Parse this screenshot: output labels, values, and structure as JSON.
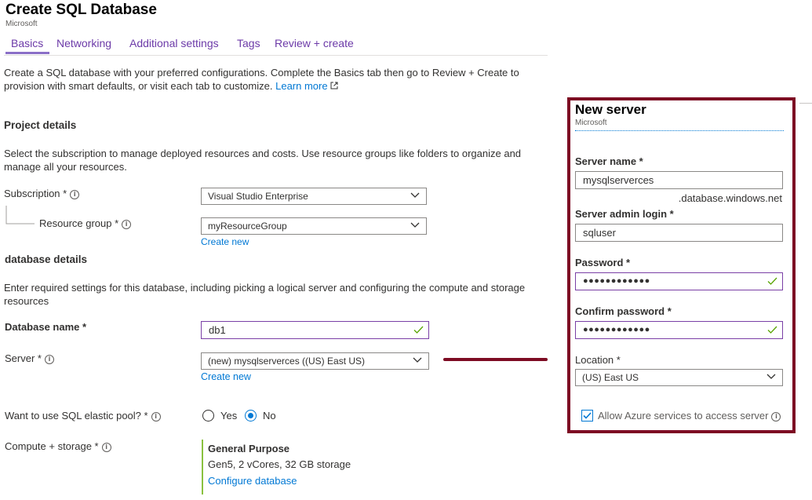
{
  "header": {
    "title": "Create SQL Database",
    "publisher": "Microsoft"
  },
  "tabs": [
    {
      "label": "Basics"
    },
    {
      "label": "Networking"
    },
    {
      "label": "Additional settings"
    },
    {
      "label": "Tags"
    },
    {
      "label": "Review + create"
    }
  ],
  "intro": {
    "line1": "Create a SQL database with your preferred configurations. Complete the Basics tab then go to Review + Create to",
    "line2": "provision with smart defaults, or visit each tab to customize.",
    "learn_more": "Learn more"
  },
  "project": {
    "heading": "Project details",
    "desc_line1": "Select the subscription to manage deployed resources and costs. Use resource groups like folders to organize and",
    "desc_line2": "manage all your resources.",
    "subscription_label": "Subscription *",
    "subscription_value": "Visual Studio Enterprise",
    "resource_group_label": "Resource group *",
    "resource_group_value": "myResourceGroup",
    "create_new": "Create new"
  },
  "database": {
    "heading": "database details",
    "desc_line1": "Enter required settings for this database, including picking a logical server and configuring the compute and storage",
    "desc_line2": "resources",
    "db_name_label": "Database name *",
    "db_name_value": "db1",
    "server_label": "Server *",
    "server_value": "(new) mysqlserverces ((US) East US)",
    "create_new": "Create new",
    "elastic_label": "Want to use SQL elastic pool? *",
    "elastic_yes": "Yes",
    "elastic_no": "No",
    "elastic_selected": "No",
    "compute_label": "Compute + storage *",
    "compute_tier": "General Purpose",
    "compute_desc": "Gen5, 2 vCores, 32 GB storage",
    "configure": "Configure database"
  },
  "new_server": {
    "title": "New server",
    "publisher": "Microsoft",
    "server_name_label": "Server name *",
    "server_name_value": "mysqlserverces",
    "server_suffix": ".database.windows.net",
    "admin_label": "Server admin login *",
    "admin_value": "sqluser",
    "password_label": "Password *",
    "password_value": "●●●●●●●●●●●●",
    "confirm_label": "Confirm password *",
    "confirm_value": "●●●●●●●●●●●●",
    "location_label": "Location *",
    "location_value": "(US) East US",
    "allow_azure_label": "Allow Azure services to access server",
    "allow_azure_checked": true
  },
  "colors": {
    "accent": "#0078d4",
    "tab_text": "#6c3aa8",
    "highlight_border": "#7d0b23",
    "valid": "#57a300"
  }
}
